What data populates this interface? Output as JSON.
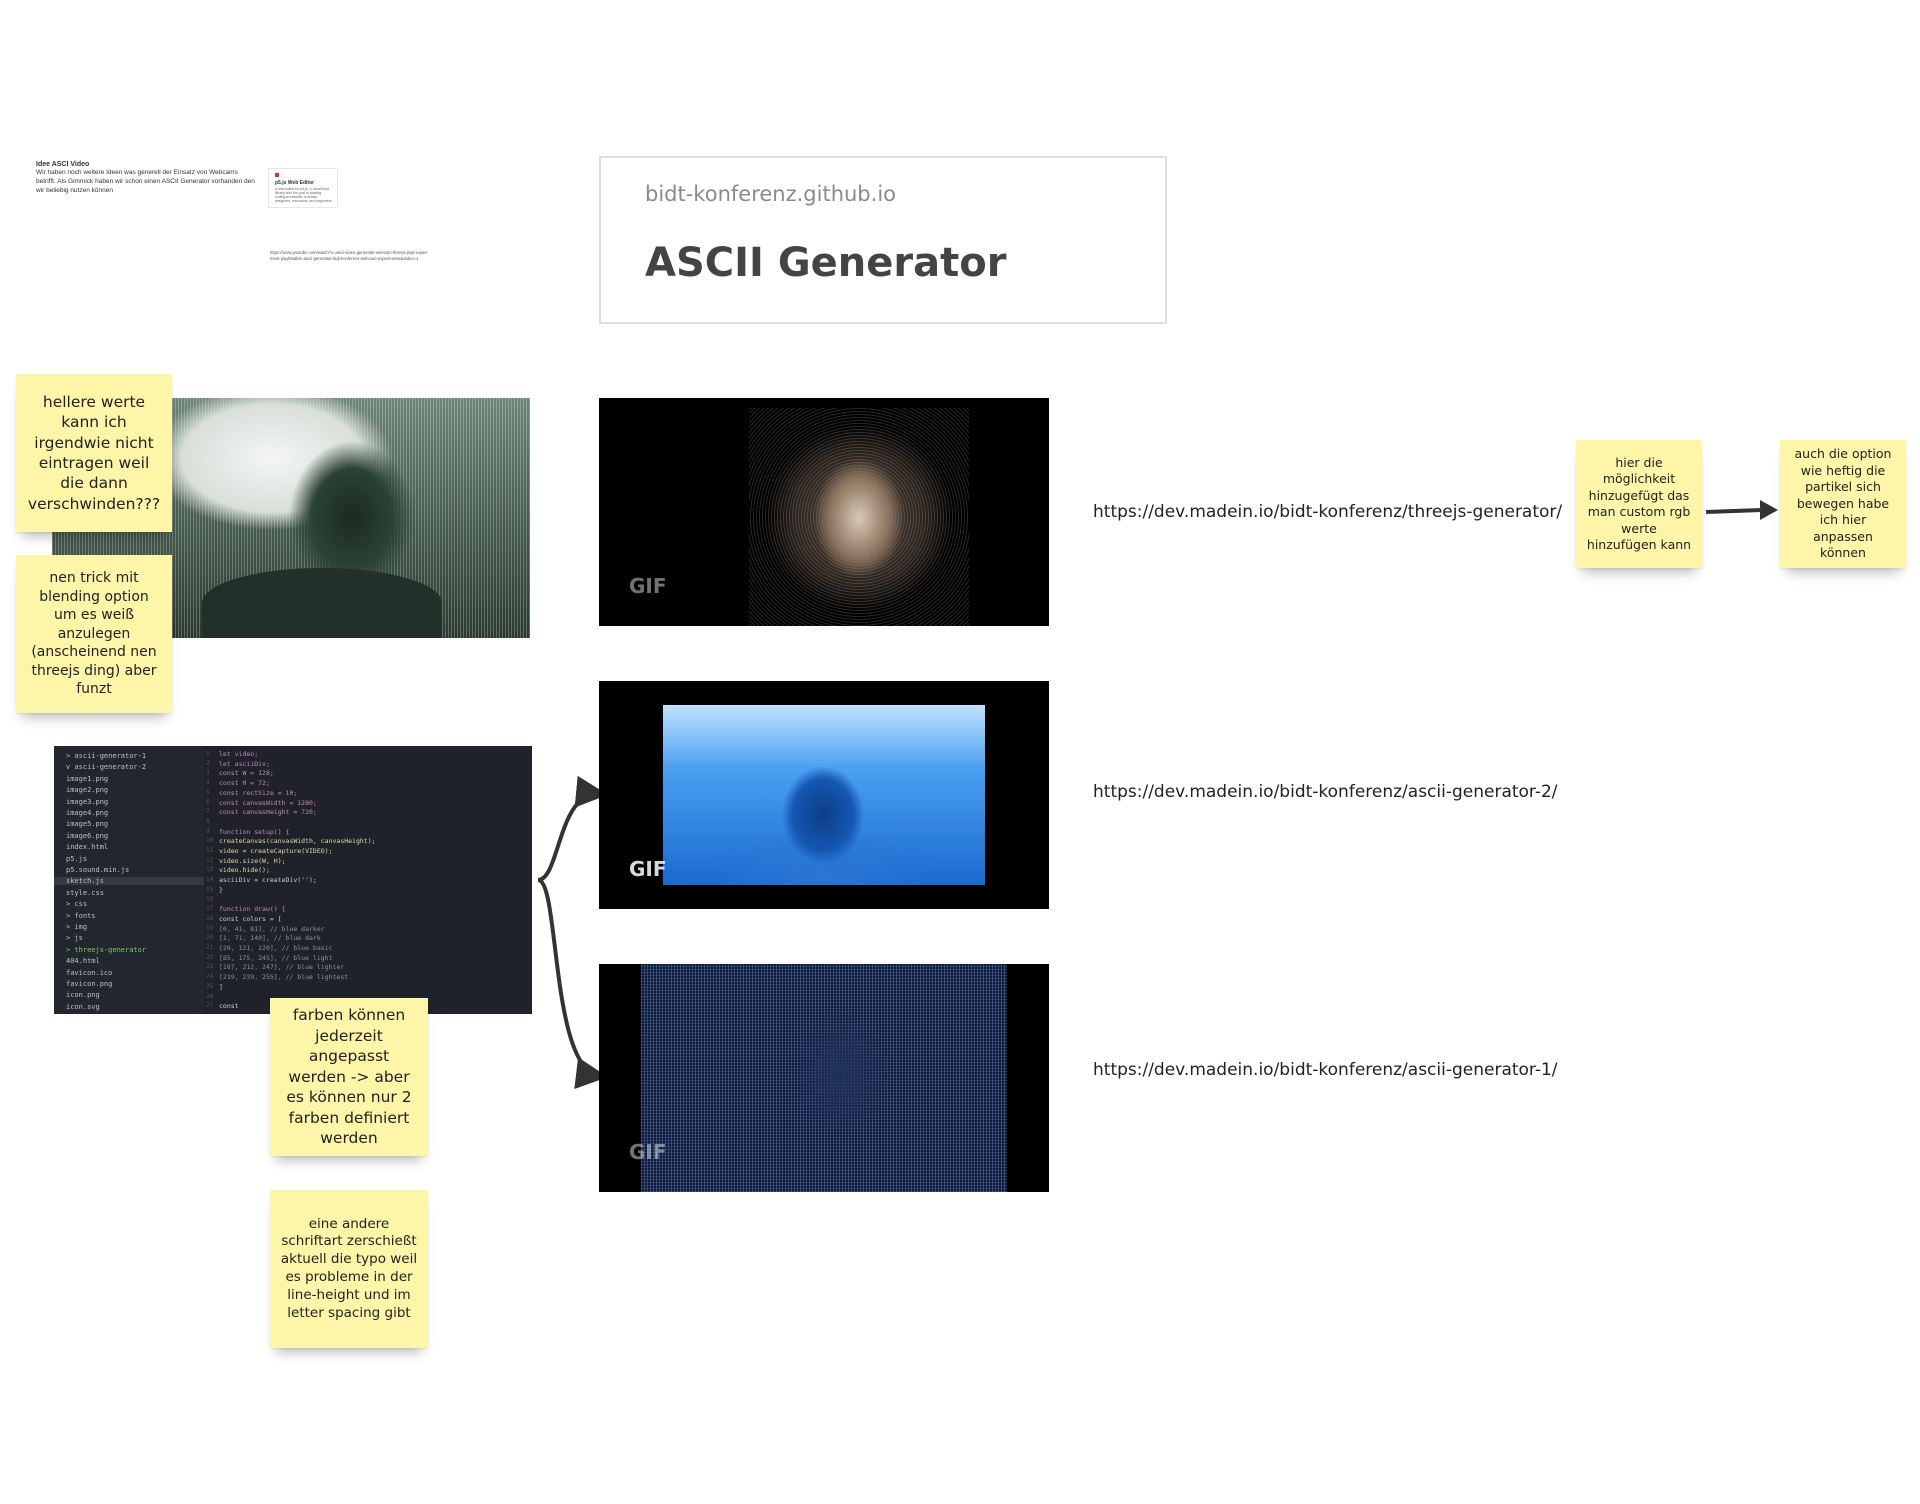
{
  "idea_note": {
    "heading": "Idee ASCI Video",
    "text": "Wir haben noch weitere Ideen was generell der Einsatz von Webcams betrifft. Als Gimmick haben wir schon einen ASCII Generator vorhanden den wir beliebig nutzen können"
  },
  "mini_card": {
    "title": "p5.js Web Editor",
    "lines": [
      "A web editor for p5.js, a JavaScript",
      "library with the goal of making",
      "coding accessible to artists,",
      "designers, educators, and beginners."
    ]
  },
  "long_url_text": "https://www.youtube.com/watch?v=ascii-video-generator-webcam-threejs-p5js-experiment-playlist&list=ascii-generator-bidt-konferenz-webcam-experimente&index=1",
  "title_card": {
    "site": "bidt-konferenz.github.io",
    "title": "ASCII Generator"
  },
  "gif_badge": "GIF",
  "links": {
    "threejs": "https://dev.madein.io/bidt-konferenz/threejs-generator/",
    "gen2": "https://dev.madein.io/bidt-konferenz/ascii-generator-2/",
    "gen1": "https://dev.madein.io/bidt-konferenz/ascii-generator-1/"
  },
  "stickies": {
    "hellere": "hellere werte kann ich irgendwie nicht eintragen weil die dann verschwinden???",
    "trick": "nen trick mit blending option um es weiß anzulegen (anscheinend nen threejs ding) aber funzt",
    "farben": "farben können jederzeit angepasst werden -> aber es können nur 2 farben definiert werden",
    "schrift": "eine andere schriftart zerschießt aktuell die typo weil es probleme in der line-height und im letter spacing gibt",
    "rgb": "hier die möglichkeit hinzugefügt das man custom rgb werte hinzufügen kann",
    "option": "auch die option wie heftig die partikel sich bewegen habe ich hier anpassen können"
  },
  "file_tree": [
    "> ascii-generator-1",
    "v ascii-generator-2",
    "  image1.png",
    "  image2.png",
    "  image3.png",
    "  image4.png",
    "  image5.png",
    "  image6.png",
    "  index.html",
    "  p5.js",
    "  p5.sound.min.js",
    "  sketch.js",
    "  style.css",
    "> css",
    "> fonts",
    "> img",
    "> js",
    "> threejs-generator",
    "  404.html",
    "  favicon.ico",
    "  favicon.png",
    "  icon.png",
    "  icon.svg"
  ],
  "code_lines": [
    "let video;",
    "let asciiDiv;",
    "const W = 128;",
    "const H = 72;",
    "const rectSize = 10;",
    "const canvasWidth = 1280;",
    "const canvasHeight = 720;",
    "",
    "function setup() {",
    "  createCanvas(canvasWidth, canvasHeight);",
    "  video = createCapture(VIDEO);",
    "  video.size(W, H);",
    "  video.hide();",
    "  asciiDiv = createDiv('');",
    "}",
    "",
    "function draw() {",
    "  const colors = [",
    "    [0, 41, 81],  // blue darker",
    "    [1, 71, 140], // blue dark",
    "    [20, 121, 220], // blue basic",
    "    [85, 175, 245], // blue light",
    "    [167, 212, 247], // blue lighter",
    "    [219, 239, 255], // blue lightest",
    "  ]",
    "",
    "  const"
  ]
}
